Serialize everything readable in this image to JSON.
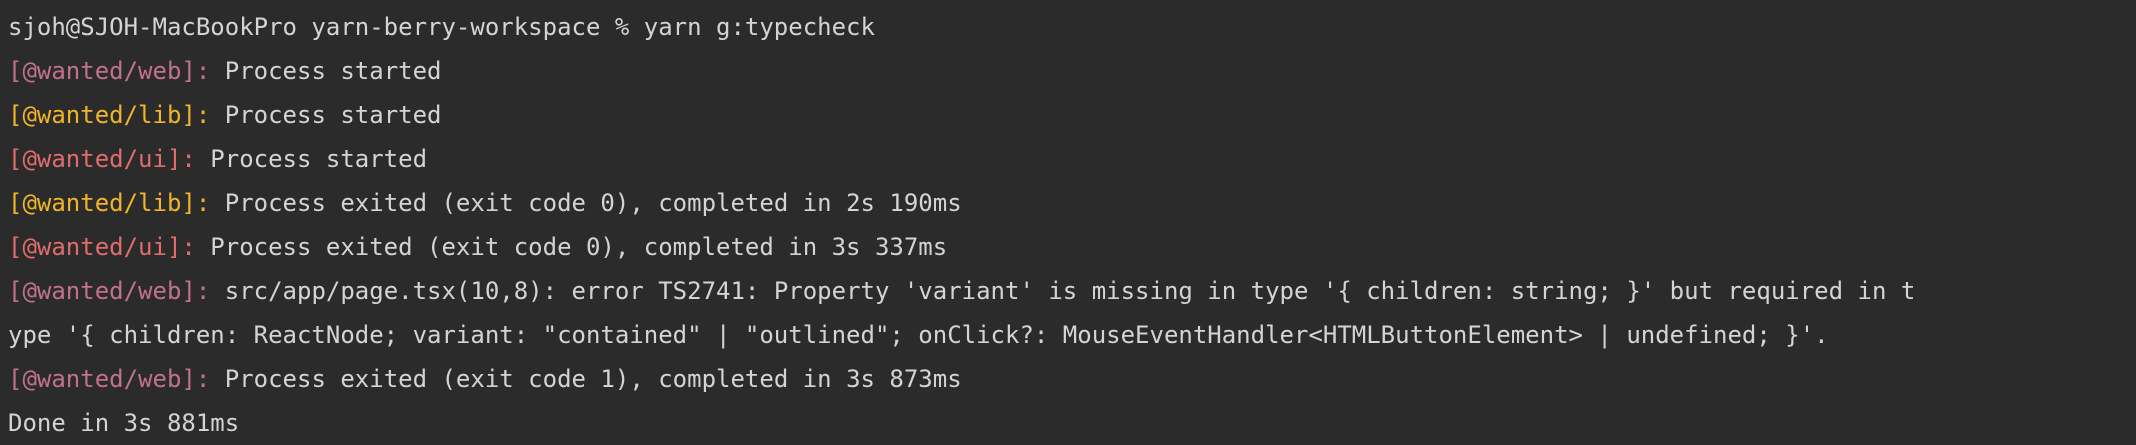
{
  "terminal": {
    "colors": {
      "background": "#2b2b2b",
      "text": "#d4d4d4",
      "web": "#c2708f",
      "lib": "#f0b429",
      "ui": "#e06c6c"
    },
    "prompt": "sjoh@SJOH-MacBookPro yarn-berry-workspace % yarn g:typecheck",
    "lines": [
      {
        "prefix": "[@wanted/web]:",
        "message": " Process started"
      },
      {
        "prefix": "[@wanted/lib]:",
        "message": " Process started"
      },
      {
        "prefix": "[@wanted/ui]:",
        "message": " Process started"
      },
      {
        "prefix": "[@wanted/lib]:",
        "message": " Process exited (exit code 0), completed in 2s 190ms"
      },
      {
        "prefix": "[@wanted/ui]:",
        "message": " Process exited (exit code 0), completed in 3s 337ms"
      },
      {
        "prefix": "[@wanted/web]:",
        "message": " src/app/page.tsx(10,8): error TS2741: Property 'variant' is missing in type '{ children: string; }' but required in t"
      },
      {
        "prefix": "",
        "message": "ype '{ children: ReactNode; variant: \"contained\" | \"outlined\"; onClick?: MouseEventHandler<HTMLButtonElement> | undefined; }'."
      },
      {
        "prefix": "[@wanted/web]:",
        "message": " Process exited (exit code 1), completed in 3s 873ms"
      }
    ],
    "done": "Done in 3s 881ms"
  }
}
